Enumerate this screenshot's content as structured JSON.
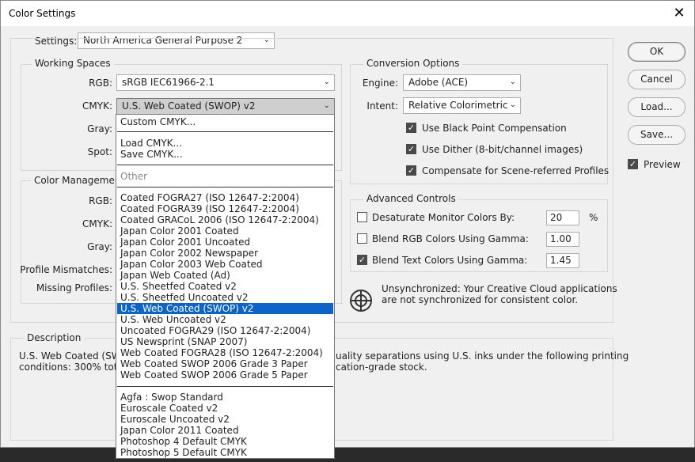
{
  "window": {
    "title": "Color Settings",
    "close_glyph": "✕"
  },
  "settings": {
    "label": "Settings:",
    "value": "North America General Purpose 2"
  },
  "working_spaces": {
    "title": "Working Spaces",
    "rgb_label": "RGB:",
    "rgb_value": "sRGB IEC61966-2.1",
    "cmyk_label": "CMYK:",
    "cmyk_value": "U.S. Web Coated (SWOP) v2",
    "gray_label": "Gray:",
    "spot_label": "Spot:"
  },
  "color_management": {
    "title": "Color Management",
    "rgb_label": "RGB:",
    "cmyk_label": "CMYK:",
    "gray_label": "Gray:",
    "mismatch_label": "Profile Mismatches:",
    "missing_label": "Missing Profiles:"
  },
  "conversion": {
    "title": "Conversion Options",
    "engine_label": "Engine:",
    "engine_value": "Adobe (ACE)",
    "intent_label": "Intent:",
    "intent_value": "Relative Colorimetric",
    "black_point": "Use Black Point Compensation",
    "dither": "Use Dither (8-bit/channel images)",
    "compensate": "Compensate for Scene-referred Profiles"
  },
  "advanced": {
    "title": "Advanced Controls",
    "desaturate": "Desaturate Monitor Colors By:",
    "desaturate_value": "20",
    "desaturate_unit": "%",
    "blend_rgb": "Blend RGB Colors Using Gamma:",
    "blend_rgb_value": "1.00",
    "blend_text": "Blend Text Colors Using Gamma:",
    "blend_text_value": "1.45"
  },
  "sync": {
    "line1": "Unsynchronized: Your Creative Cloud applications",
    "line2": "are not synchronized for consistent color."
  },
  "description": {
    "title": "Description",
    "line1_left": "U.S. Web Coated (SWO",
    "line1_right": "uality separations using U.S. inks under the following printing",
    "line2_left": "conditions: 300% tota",
    "line2_right": "cation-grade stock."
  },
  "buttons": {
    "ok": "OK",
    "cancel": "Cancel",
    "load": "Load...",
    "save": "Save...",
    "preview": "Preview"
  },
  "dropdown": {
    "custom": "Custom CMYK...",
    "load": "Load CMYK...",
    "save": "Save CMYK...",
    "other": "Other",
    "group1": [
      "Coated FOGRA27 (ISO 12647-2:2004)",
      "Coated FOGRA39 (ISO 12647-2:2004)",
      "Coated GRACoL 2006 (ISO 12647-2:2004)",
      "Japan Color 2001 Coated",
      "Japan Color 2001 Uncoated",
      "Japan Color 2002 Newspaper",
      "Japan Color 2003 Web Coated",
      "Japan Web Coated (Ad)",
      "U.S. Sheetfed Coated v2",
      "U.S. Sheetfed Uncoated v2",
      "U.S. Web Coated (SWOP) v2",
      "U.S. Web Uncoated v2",
      "Uncoated FOGRA29 (ISO 12647-2:2004)",
      "US Newsprint (SNAP 2007)",
      "Web Coated FOGRA28 (ISO 12647-2:2004)",
      "Web Coated SWOP 2006 Grade 3 Paper",
      "Web Coated SWOP 2006 Grade 5 Paper"
    ],
    "group2": [
      "Agfa : Swop Standard",
      "Euroscale Coated v2",
      "Euroscale Uncoated v2",
      "Japan Color 2011 Coated",
      "Photoshop 4 Default CMYK",
      "Photoshop 5 Default CMYK"
    ]
  }
}
